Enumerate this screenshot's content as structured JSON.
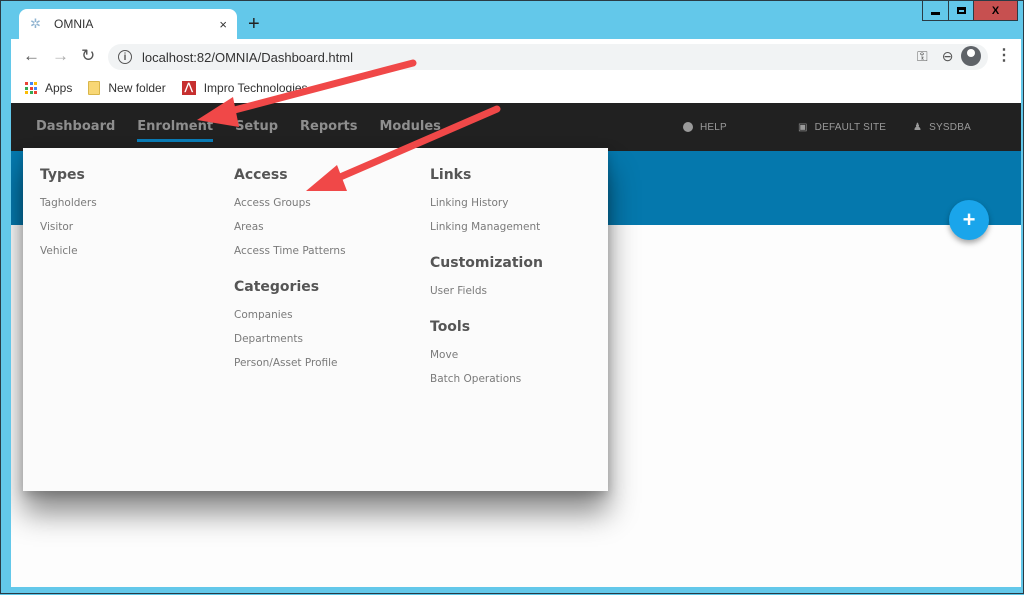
{
  "browser": {
    "tab_title": "OMNIA",
    "tab_close": "×",
    "new_tab": "+",
    "url": "localhost:82/OMNIA/Dashboard.html",
    "bookmarks": [
      {
        "label": "Apps",
        "icon": "apps-grid-icon"
      },
      {
        "label": "New folder",
        "icon": "folder-icon"
      },
      {
        "label": "Impro Technologies",
        "icon": "impro-icon"
      }
    ],
    "window_controls": {
      "close": "X"
    }
  },
  "app": {
    "nav": [
      {
        "label": "Dashboard",
        "active": false
      },
      {
        "label": "Enrolment",
        "active": true
      },
      {
        "label": "Setup",
        "active": false
      },
      {
        "label": "Reports",
        "active": false
      },
      {
        "label": "Modules",
        "active": false
      }
    ],
    "right_nav": {
      "help": "HELP",
      "site": "DEFAULT SITE",
      "user": "SYSDBA"
    },
    "fab_label": "+",
    "colors": {
      "appbar": "#212121",
      "banner": "#0578ad",
      "active_underline": "#0a7bb5",
      "fab": "#1aa5eb",
      "annotation_arrow": "#f04040"
    }
  },
  "menu": {
    "columns": [
      {
        "groups": [
          {
            "title": "Types",
            "items": [
              "Tagholders",
              "Visitor",
              "Vehicle"
            ]
          }
        ]
      },
      {
        "groups": [
          {
            "title": "Access",
            "items": [
              "Access Groups",
              "Areas",
              "Access Time Patterns"
            ]
          },
          {
            "title": "Categories",
            "items": [
              "Companies",
              "Departments",
              "Person/Asset Profile"
            ]
          }
        ]
      },
      {
        "groups": [
          {
            "title": "Links",
            "items": [
              "Linking History",
              "Linking Management"
            ]
          },
          {
            "title": "Customization",
            "items": [
              "User Fields"
            ]
          },
          {
            "title": "Tools",
            "items": [
              "Move",
              "Batch Operations"
            ]
          }
        ]
      }
    ]
  }
}
